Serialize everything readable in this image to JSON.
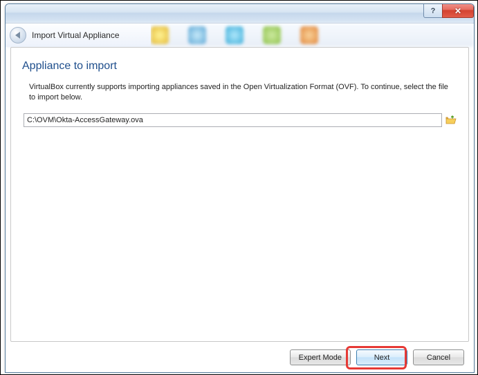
{
  "window": {
    "help_symbol": "?",
    "close_symbol": "✕"
  },
  "header": {
    "title": "Import Virtual Appliance"
  },
  "page": {
    "heading": "Appliance to import",
    "description": "VirtualBox currently supports importing appliances saved in the Open Virtualization Format (OVF). To continue, select the file to import below."
  },
  "file": {
    "path": "C:\\OVM\\Okta-AccessGateway.ova"
  },
  "buttons": {
    "expert_mode": "Expert Mode",
    "next": "Next",
    "cancel": "Cancel"
  }
}
